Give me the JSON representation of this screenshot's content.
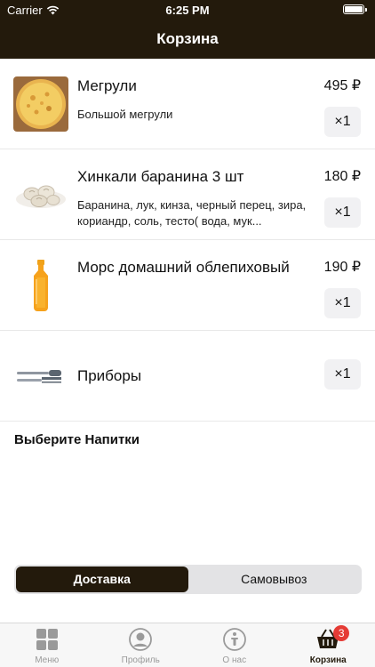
{
  "status_bar": {
    "carrier": "Carrier",
    "time": "6:25 PM"
  },
  "nav": {
    "title": "Корзина"
  },
  "cart_items": [
    {
      "name": "Мегрули",
      "description": "Большой мегрули",
      "price": "495 ₽",
      "quantity": "×1",
      "icon": "pizza-image"
    },
    {
      "name": "Хинкали баранина 3 шт",
      "description": "Баранина, лук, кинза, черный перец, зира, кориандр, соль, тесто( вода, мук...",
      "price": "180 ₽",
      "quantity": "×1",
      "icon": "dumplings-image"
    },
    {
      "name": "Морс домашний облепиховый",
      "description": "",
      "price": "190 ₽",
      "quantity": "×1",
      "icon": "juice-bottle-image"
    },
    {
      "name": "Приборы",
      "description": "",
      "price": "",
      "quantity": "×1",
      "icon": "cutlery-icon"
    }
  ],
  "drinks_section": {
    "title": "Выберите Напитки"
  },
  "delivery_toggle": {
    "options": [
      "Доставка",
      "Самовывоз"
    ],
    "selected": "Доставка"
  },
  "tabbar": {
    "items": [
      {
        "label": "Меню",
        "icon": "grid-icon",
        "active": false
      },
      {
        "label": "Профиль",
        "icon": "profile-icon",
        "active": false
      },
      {
        "label": "О нас",
        "icon": "info-icon",
        "active": false
      },
      {
        "label": "Корзина",
        "icon": "basket-icon",
        "active": true,
        "badge": "3"
      }
    ]
  },
  "colors": {
    "header_bg": "#231a0c",
    "accent": "#231a0c",
    "badge": "#e53b35"
  }
}
